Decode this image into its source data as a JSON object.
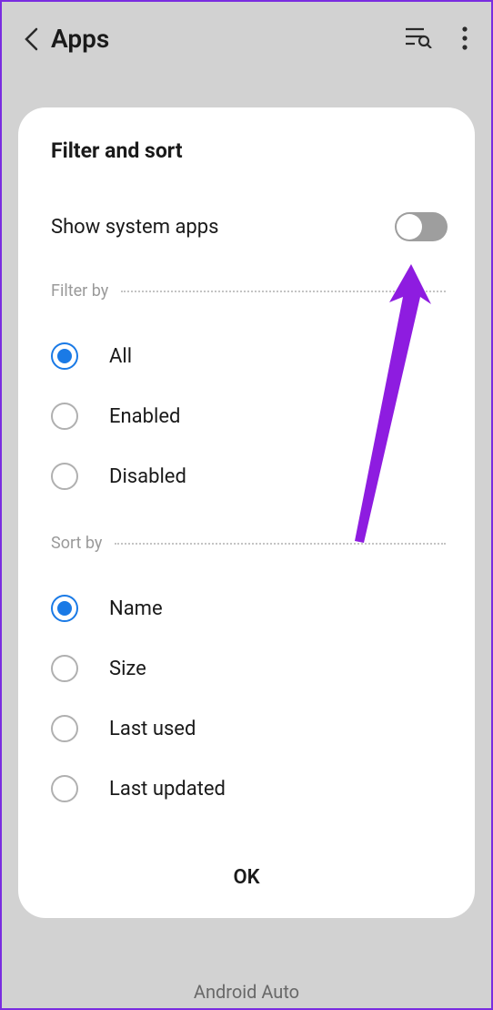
{
  "header": {
    "title": "Apps"
  },
  "dialog": {
    "title": "Filter and sort",
    "toggle": {
      "label": "Show system apps",
      "state": false
    },
    "filter": {
      "section_label": "Filter by",
      "options": [
        {
          "label": "All",
          "selected": true
        },
        {
          "label": "Enabled",
          "selected": false
        },
        {
          "label": "Disabled",
          "selected": false
        }
      ]
    },
    "sort": {
      "section_label": "Sort by",
      "options": [
        {
          "label": "Name",
          "selected": true
        },
        {
          "label": "Size",
          "selected": false
        },
        {
          "label": "Last used",
          "selected": false
        },
        {
          "label": "Last updated",
          "selected": false
        }
      ]
    },
    "ok_label": "OK"
  },
  "background_app": "Android Auto",
  "annotation": {
    "color": "#8e1ce0"
  }
}
